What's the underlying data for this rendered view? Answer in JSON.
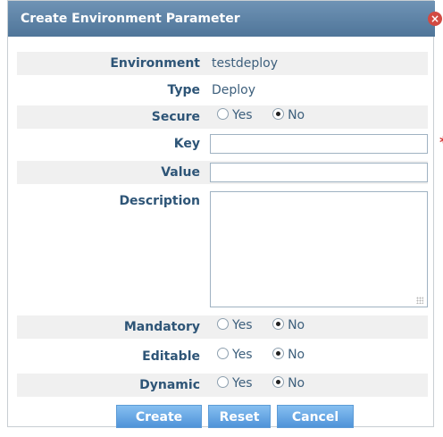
{
  "dialog": {
    "title": "Create Environment Parameter",
    "close": "×"
  },
  "fields": {
    "environment": {
      "label": "Environment",
      "value": "testdeploy"
    },
    "type": {
      "label": "Type",
      "value": "Deploy"
    },
    "secure": {
      "label": "Secure",
      "yes": "Yes",
      "no": "No",
      "selected": "No"
    },
    "key": {
      "label": "Key",
      "value": "",
      "placeholder": ""
    },
    "value": {
      "label": "Value",
      "value": "",
      "placeholder": ""
    },
    "description": {
      "label": "Description",
      "value": ""
    },
    "mandatory": {
      "label": "Mandatory",
      "yes": "Yes",
      "no": "No",
      "selected": "No"
    },
    "editable": {
      "label": "Editable",
      "yes": "Yes",
      "no": "No",
      "selected": "No"
    },
    "dynamic": {
      "label": "Dynamic",
      "yes": "Yes",
      "no": "No",
      "selected": "No"
    }
  },
  "required_marker": "*",
  "buttons": {
    "create": "Create",
    "reset": "Reset",
    "cancel": "Cancel"
  },
  "colors": {
    "titlebar": "#5b80a4",
    "label": "#2e5577",
    "value": "#3d5f7c",
    "row_shade": "#f0f0f0",
    "button": "#5b9be0",
    "required": "#d32d2d"
  }
}
